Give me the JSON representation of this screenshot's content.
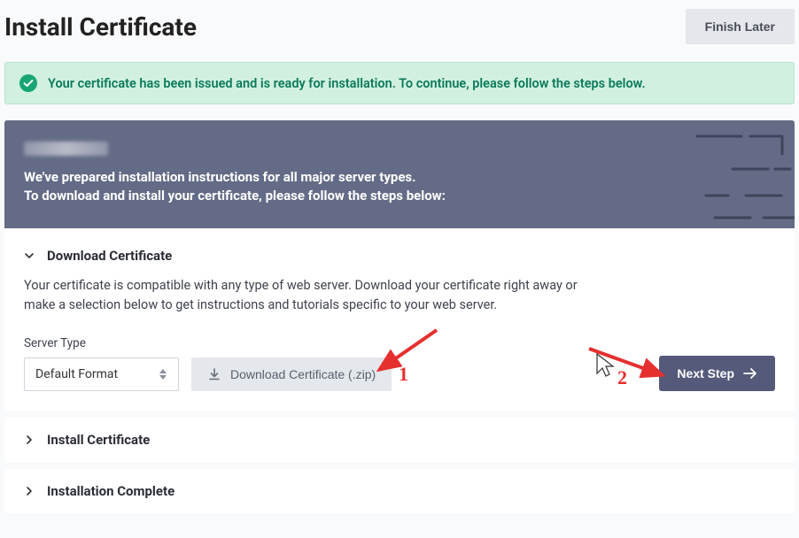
{
  "header": {
    "title": "Install Certificate",
    "finish_later": "Finish Later"
  },
  "alert": {
    "message": "Your certificate has been issued and is ready for installation. To continue, please follow the steps below."
  },
  "banner": {
    "line1": "We've prepared installation instructions for all major server types.",
    "line2": "To download and install your certificate, please follow the steps below:"
  },
  "download_section": {
    "title": "Download Certificate",
    "description": "Your certificate is compatible with any type of web server. Download your certificate right away or make a selection below to get instructions and tutorials specific to your web server.",
    "field_label": "Server Type",
    "select_value": "Default Format",
    "download_button": "Download Certificate (.zip)",
    "next_button": "Next Step"
  },
  "steps": {
    "install": "Install Certificate",
    "complete": "Installation Complete"
  },
  "annotations": {
    "num1": "1",
    "num2": "2"
  }
}
